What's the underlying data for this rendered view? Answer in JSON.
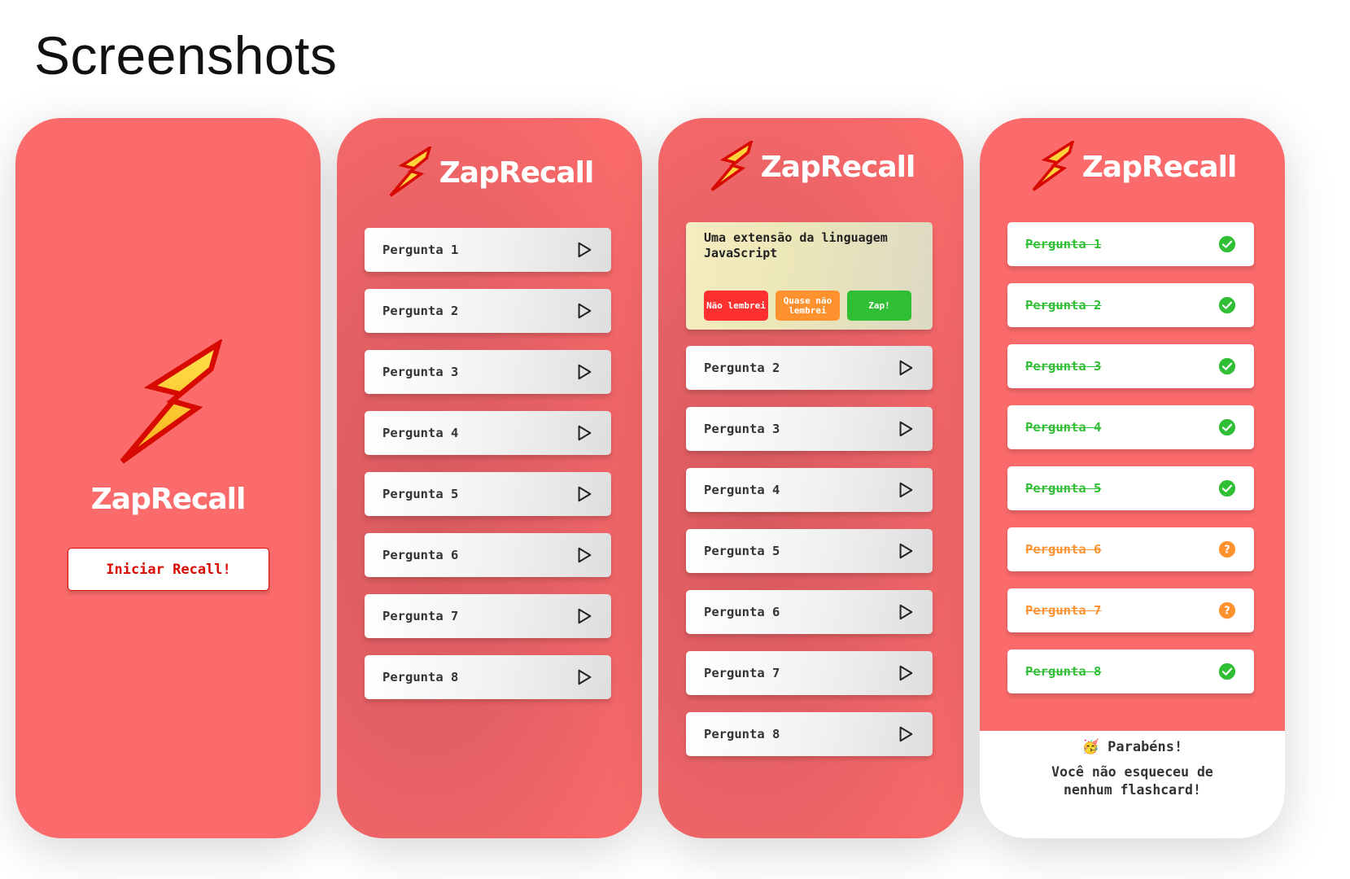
{
  "page": {
    "title": "Screenshots"
  },
  "app": {
    "name": "ZapRecall"
  },
  "welcome": {
    "start_label": "Iniciar Recall!"
  },
  "questions": [
    "Pergunta 1",
    "Pergunta 2",
    "Pergunta 3",
    "Pergunta 4",
    "Pergunta 5",
    "Pergunta 6",
    "Pergunta 7",
    "Pergunta 8"
  ],
  "question_card": {
    "answer_text": "Uma extensão da linguagem JavaScript",
    "buttons": [
      {
        "label": "Não lembrei",
        "color": "#FF3030"
      },
      {
        "label": "Quase não lembrei",
        "color": "#FF922E"
      },
      {
        "label": "Zap!",
        "color": "#2FBE34"
      }
    ]
  },
  "results": {
    "items": [
      {
        "label": "Pergunta 1",
        "status": "zap"
      },
      {
        "label": "Pergunta 2",
        "status": "zap"
      },
      {
        "label": "Pergunta 3",
        "status": "zap"
      },
      {
        "label": "Pergunta 4",
        "status": "zap"
      },
      {
        "label": "Pergunta 5",
        "status": "zap"
      },
      {
        "label": "Pergunta 6",
        "status": "almost"
      },
      {
        "label": "Pergunta 7",
        "status": "almost"
      },
      {
        "label": "Pergunta 8",
        "status": "zap"
      }
    ],
    "congrats": "🥳 Parabéns!",
    "message": "Você não esqueceu de nenhum flashcard!"
  },
  "colors": {
    "background": "#FB6B6B",
    "zap": "#2FBE34",
    "almost": "#FF922E",
    "wrong": "#FF3030",
    "accent": "#D70900"
  },
  "icons": {
    "logo": "lightning-logo",
    "play": "play-icon",
    "zap": "check-circle-icon",
    "almost": "help-circle-icon"
  }
}
